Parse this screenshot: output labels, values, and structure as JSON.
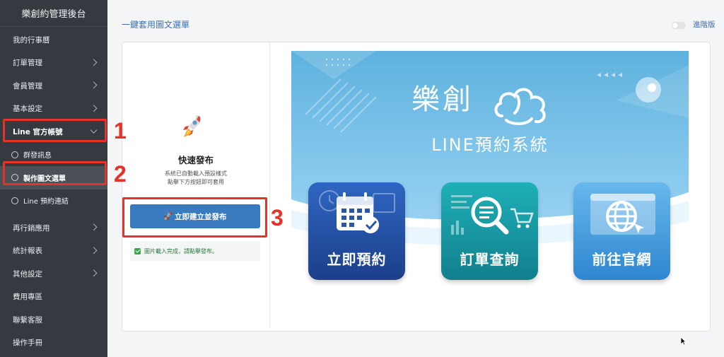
{
  "sidebar": {
    "title": "樂創約管理後台",
    "items": [
      {
        "label": "我的行事曆"
      },
      {
        "label": "訂單管理"
      },
      {
        "label": "會員管理"
      },
      {
        "label": "基本設定"
      },
      {
        "label": "Line 官方帳號"
      },
      {
        "label": "群發訊息"
      },
      {
        "label": "製作圖文選單"
      },
      {
        "label": "Line 預約連結"
      },
      {
        "label": "再行銷應用"
      },
      {
        "label": "統計報表"
      },
      {
        "label": "其他設定"
      },
      {
        "label": "費用專區"
      },
      {
        "label": "聯繫客服"
      },
      {
        "label": "操作手冊"
      }
    ]
  },
  "annotations": [
    "1",
    "2",
    "3"
  ],
  "header": {
    "title": "一鍵套用圖文選單",
    "advanced_label": "進階版",
    "advanced_toggle_on": false
  },
  "quick_publish": {
    "icon": "rocket-icon",
    "title": "快速發布",
    "desc_line1": "系統已自動載入預設樣式",
    "desc_line2": "點擊下方按鈕即可套用",
    "button_icon": "🚀",
    "button_label": "立即建立並發布",
    "notice": "圖片載入完成，請點擊發布。"
  },
  "banner": {
    "brand": "樂創",
    "system": "LINE預約系統",
    "tiles": [
      {
        "label": "立即預約",
        "icon": "calendar-check-icon",
        "color": "#2a55a8"
      },
      {
        "label": "訂單查詢",
        "icon": "search-cart-icon",
        "color": "#189aa6"
      },
      {
        "label": "前往官網",
        "icon": "globe-icon",
        "color": "#4aa0dd"
      }
    ]
  },
  "colors": {
    "sidebar_bg": "#343a40",
    "accent": "#3a7abf",
    "annotation": "#e5332a",
    "banner_sky": "#6fbbe3"
  }
}
